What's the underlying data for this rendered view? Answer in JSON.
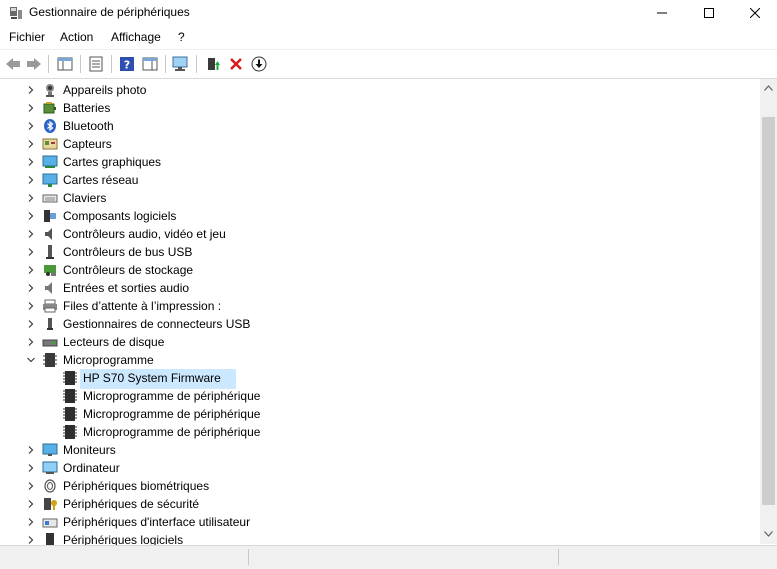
{
  "window": {
    "title": "Gestionnaire de périphériques"
  },
  "menu": {
    "items": [
      "Fichier",
      "Action",
      "Affichage",
      "?"
    ]
  },
  "tree": {
    "items": [
      {
        "label": "Appareils photo",
        "icon": "camera-icon"
      },
      {
        "label": "Batteries",
        "icon": "battery-icon"
      },
      {
        "label": "Bluetooth",
        "icon": "bluetooth-icon"
      },
      {
        "label": "Capteurs",
        "icon": "sensor-icon"
      },
      {
        "label": "Cartes graphiques",
        "icon": "display-adapter-icon"
      },
      {
        "label": "Cartes réseau",
        "icon": "network-adapter-icon"
      },
      {
        "label": "Claviers",
        "icon": "keyboard-icon"
      },
      {
        "label": "Composants logiciels",
        "icon": "software-component-icon"
      },
      {
        "label": "Contrôleurs audio, vidéo et jeu",
        "icon": "audio-video-icon"
      },
      {
        "label": "Contrôleurs de bus USB",
        "icon": "usb-controller-icon"
      },
      {
        "label": "Contrôleurs de stockage",
        "icon": "storage-controller-icon"
      },
      {
        "label": "Entrées et sorties audio",
        "icon": "audio-io-icon"
      },
      {
        "label": "Files d’attente à l’impression :",
        "icon": "print-queue-icon"
      },
      {
        "label": "Gestionnaires de connecteurs USB",
        "icon": "usb-connector-icon"
      },
      {
        "label": "Lecteurs de disque",
        "icon": "disk-drive-icon"
      },
      {
        "label": "Microprogramme",
        "icon": "firmware-icon",
        "expanded": true
      },
      {
        "label": "HP S70 System Firmware",
        "icon": "firmware-chip-icon",
        "child": true,
        "selected": true
      },
      {
        "label": "Microprogramme de périphérique",
        "icon": "firmware-chip-icon",
        "child": true
      },
      {
        "label": "Microprogramme de périphérique",
        "icon": "firmware-chip-icon",
        "child": true
      },
      {
        "label": "Microprogramme de périphérique",
        "icon": "firmware-chip-icon",
        "child": true
      },
      {
        "label": "Moniteurs",
        "icon": "monitor-icon"
      },
      {
        "label": "Ordinateur",
        "icon": "computer-icon"
      },
      {
        "label": "Périphériques biométriques",
        "icon": "biometric-icon"
      },
      {
        "label": "Périphériques de sécurité",
        "icon": "security-device-icon"
      },
      {
        "label": "Périphériques d'interface utilisateur",
        "icon": "hid-icon"
      },
      {
        "label": "Périphériques logiciels",
        "icon": "software-device-icon"
      }
    ]
  },
  "colors": {
    "selection": "#cce8ff",
    "accent": "#0078d7"
  }
}
